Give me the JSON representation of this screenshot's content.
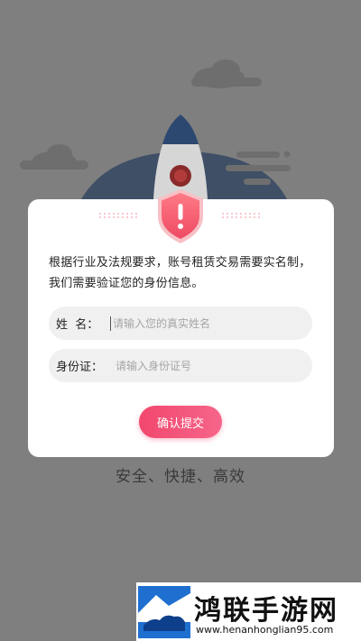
{
  "verification": {
    "notice": "根据行业及法规要求，账号租赁交易需要实名制，我们需要验证您的身份信息。",
    "name_label": "姓  名：",
    "name_placeholder": "请输入您的真实姓名",
    "id_label": "身份证：",
    "id_placeholder": "请输入身份证号",
    "submit_label": "确认提交"
  },
  "tagline": "安全、快捷、高效",
  "watermark": {
    "title": "鸿联手游网",
    "url": "www.henanhonglian95.com"
  },
  "colors": {
    "overlay": "#7f7f7f",
    "accent": "#f2476e",
    "shield": "#f05a6e"
  }
}
